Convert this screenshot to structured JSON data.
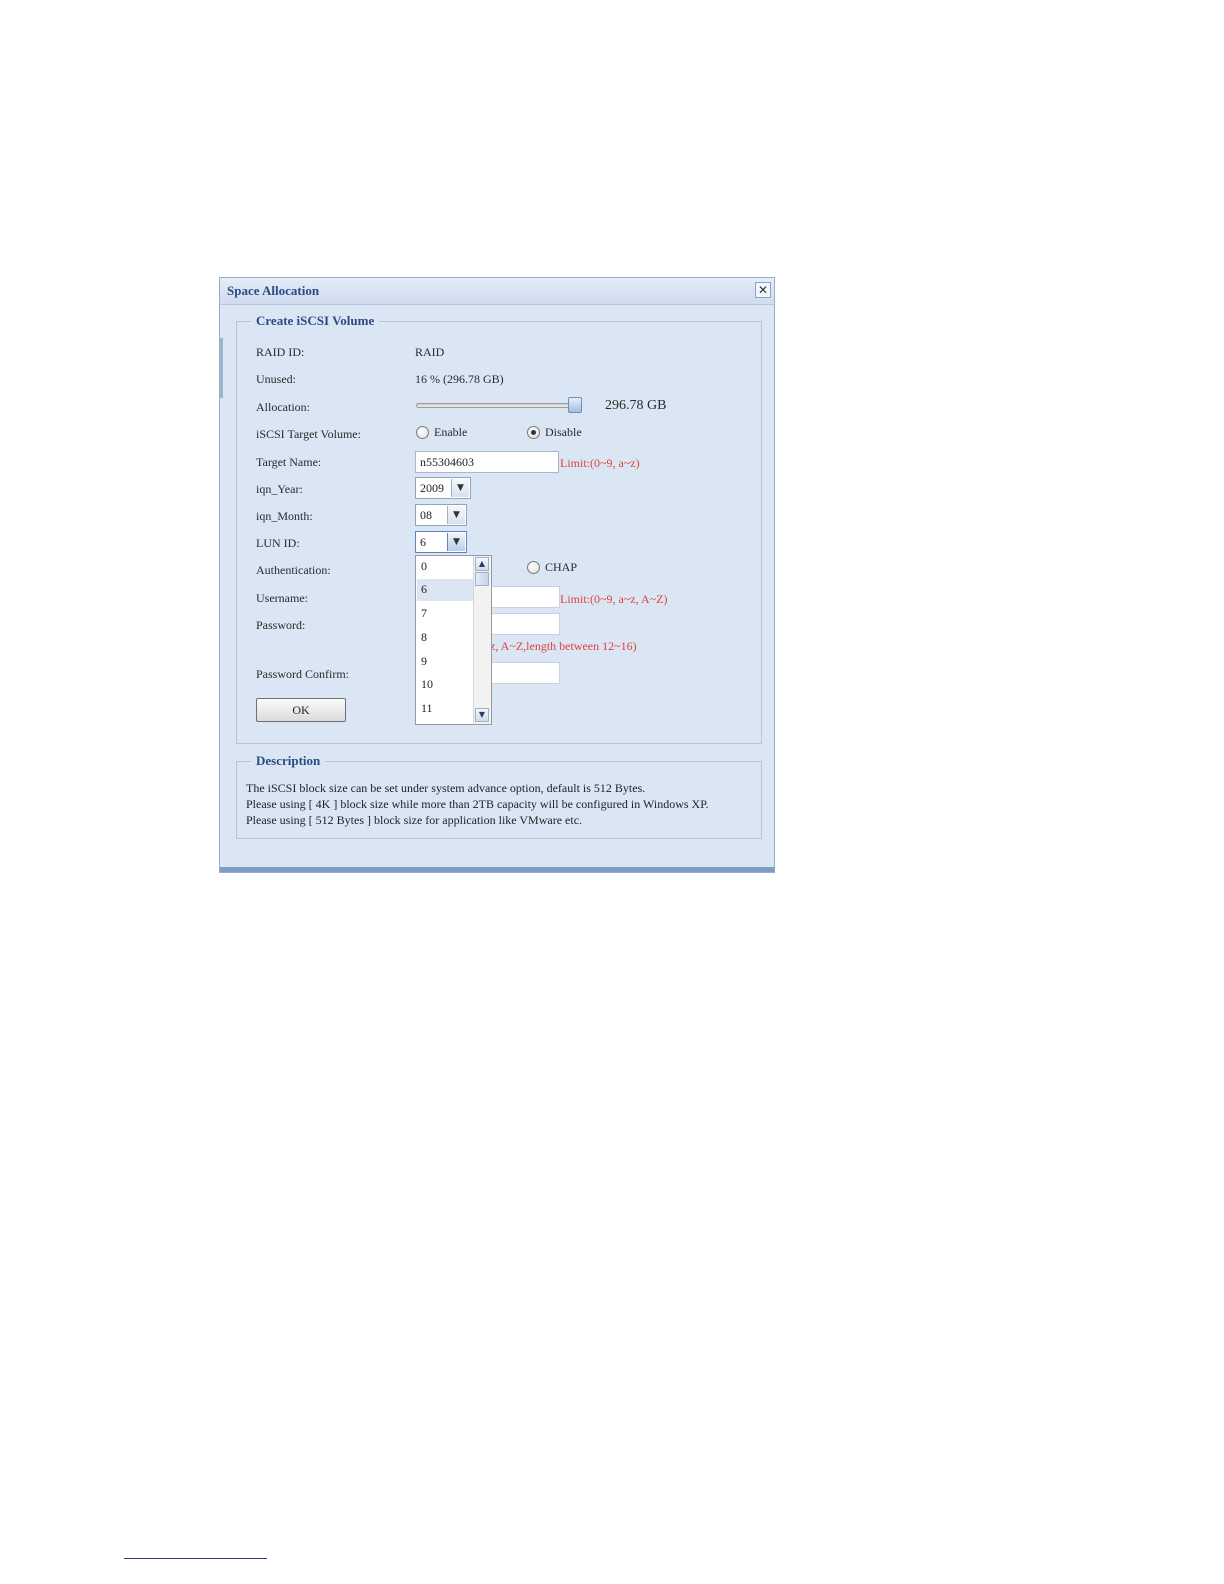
{
  "dialog": {
    "title": "Space Allocation",
    "close_icon": "close-icon",
    "section_title": "Create iSCSI Volume",
    "fields": {
      "raid_id_label": "RAID ID:",
      "raid_id_value": "RAID",
      "unused_label": "Unused:",
      "unused_value": "16 % (296.78 GB)",
      "allocation_label": "Allocation:",
      "allocation_value": "296.78 GB",
      "allocation_fraction": 1.0,
      "target_volume_label": "iSCSI Target Volume:",
      "enable_label": "Enable",
      "disable_label": "Disable",
      "target_volume_selected": "Disable",
      "target_name_label": "Target Name:",
      "target_name_value": "n55304603",
      "target_name_limit": "Limit:(0~9, a~z)",
      "iqn_year_label": "iqn_Year:",
      "iqn_year_value": "2009",
      "iqn_month_label": "iqn_Month:",
      "iqn_month_value": "08",
      "lun_id_label": "LUN ID:",
      "lun_id_value": "6",
      "authentication_label": "Authentication:",
      "chap_label": "CHAP",
      "username_label": "Username:",
      "username_limit": "Limit:(0~9, a~z, A~Z)",
      "password_label": "Password:",
      "password_limit_partial": "z, A~Z,length between 12~16)",
      "password_confirm_label": "Password Confirm:",
      "ok_button": "OK"
    },
    "lun_dropdown": {
      "options": [
        "0",
        "6",
        "7",
        "8",
        "9",
        "10",
        "11"
      ],
      "highlighted": "6"
    },
    "description": {
      "title": "Description",
      "lines": [
        "The iSCSI block size can be set under system advance option, default is 512 Bytes.",
        "Please using [ 4K ] block size while more than 2TB capacity will be configured in Windows XP.",
        "Please using [ 512 Bytes ] block size for application like VMware etc."
      ]
    }
  }
}
